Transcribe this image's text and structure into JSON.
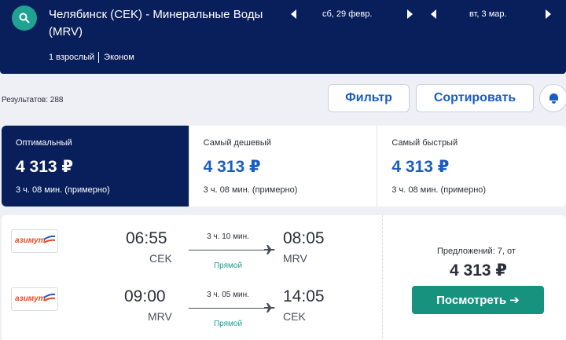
{
  "header": {
    "route": "Челябинск (CEK) - Минеральные Воды (MRV)",
    "passengers": "1 взрослый",
    "cabin": "Эконом",
    "depart_date": "сб, 29 февр.",
    "return_date": "вт, 3 мар."
  },
  "toolbar": {
    "results": "Результатов: 288",
    "filter": "Фильтр",
    "sort": "Сортировать"
  },
  "tabs": [
    {
      "name": "Оптимальный",
      "price": "4 313 ₽",
      "duration": "3 ч. 08 мин. (примерно)"
    },
    {
      "name": "Самый дешевый",
      "price": "4 313 ₽",
      "duration": "3 ч. 08 мин. (примерно)"
    },
    {
      "name": "Самый быстрый",
      "price": "4 313 ₽",
      "duration": "3 ч. 08 мин. (примерно)"
    }
  ],
  "result": {
    "airline": "азимут",
    "outbound": {
      "dep_time": "06:55",
      "dep_code": "CEK",
      "duration": "3 ч. 10 мин.",
      "type": "Прямой",
      "arr_time": "08:05",
      "arr_code": "MRV"
    },
    "inbound": {
      "dep_time": "09:00",
      "dep_code": "MRV",
      "duration": "3 ч. 05 мин.",
      "type": "Прямой",
      "arr_time": "14:05",
      "arr_code": "CEK"
    },
    "offers": "Предложений: 7, от",
    "price": "4 313 ₽",
    "view": "Посмотреть ➔"
  },
  "colors": {
    "header": "#091f5b",
    "accent": "#1a5dc2",
    "green": "#17927e"
  }
}
